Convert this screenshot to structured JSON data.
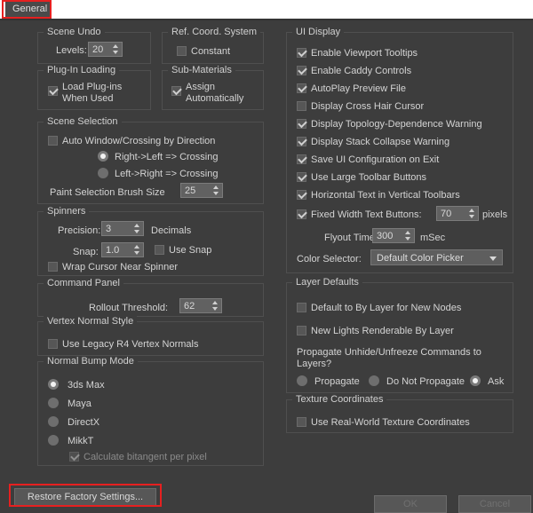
{
  "tabs": [
    {
      "label": "General",
      "selected": true
    }
  ],
  "left_column": {
    "scene_undo": {
      "title": "Scene Undo",
      "levels_label": "Levels:",
      "levels_value": "20"
    },
    "ref_coord_system": {
      "title": "Ref. Coord. System",
      "constant_label": "Constant",
      "constant_checked": false
    },
    "plugin_loading": {
      "title": "Plug-In Loading",
      "load_plugins_label_line1": "Load Plug-ins",
      "load_plugins_label_line2": "When Used",
      "load_plugins_checked": true
    },
    "sub_materials": {
      "title": "Sub-Materials",
      "assign_label_line1": "Assign",
      "assign_label_line2": "Automatically",
      "assign_checked": true
    },
    "scene_selection": {
      "title": "Scene Selection",
      "auto_window_label": "Auto Window/Crossing by Direction",
      "auto_window_checked": false,
      "right_left_label": "Right->Left => Crossing",
      "right_left_selected": true,
      "left_right_label": "Left->Right => Crossing",
      "left_right_selected": false,
      "brush_size_label": "Paint Selection Brush Size",
      "brush_size_value": "25"
    },
    "spinners": {
      "title": "Spinners",
      "precision_label": "Precision:",
      "precision_value": "3",
      "decimals_label": "Decimals",
      "snap_label": "Snap:",
      "snap_value": "1.0",
      "use_snap_label": "Use Snap",
      "use_snap_checked": false,
      "wrap_cursor_label": "Wrap Cursor Near Spinner",
      "wrap_cursor_checked": false
    },
    "command_panel": {
      "title": "Command Panel",
      "rollout_threshold_label": "Rollout Threshold:",
      "rollout_threshold_value": "62"
    },
    "vertex_normal_style": {
      "title": "Vertex Normal Style",
      "legacy_label": "Use Legacy R4 Vertex Normals",
      "legacy_checked": false
    },
    "normal_bump_mode": {
      "title": "Normal Bump Mode",
      "options": [
        {
          "label": "3ds Max",
          "selected": true
        },
        {
          "label": "Maya",
          "selected": false
        },
        {
          "label": "DirectX",
          "selected": false
        },
        {
          "label": "MikkT",
          "selected": false
        }
      ],
      "calculate_bitangent_label": "Calculate bitangent per pixel",
      "calculate_bitangent_checked": true,
      "calculate_bitangent_disabled": true
    }
  },
  "right_column": {
    "ui_display": {
      "title": "UI Display",
      "items": [
        {
          "label": "Enable Viewport Tooltips",
          "checked": true
        },
        {
          "label": "Enable Caddy Controls",
          "checked": true
        },
        {
          "label": "AutoPlay Preview File",
          "checked": true
        },
        {
          "label": "Display Cross Hair Cursor",
          "checked": false
        },
        {
          "label": "Display Topology-Dependence Warning",
          "checked": true
        },
        {
          "label": "Display Stack Collapse Warning",
          "checked": true
        },
        {
          "label": "Save UI Configuration on Exit",
          "checked": true
        },
        {
          "label": "Use Large Toolbar Buttons",
          "checked": true
        },
        {
          "label": "Horizontal Text in Vertical Toolbars",
          "checked": true
        }
      ],
      "fixed_width_label": "Fixed Width Text Buttons:",
      "fixed_width_checked": true,
      "fixed_width_value": "70",
      "pixels_label": "pixels",
      "flyout_time_label": "Flyout Time:",
      "flyout_time_value": "300",
      "msec_label": "mSec",
      "color_selector_label": "Color Selector:",
      "color_selector_value": "Default Color Picker"
    },
    "layer_defaults": {
      "title": "Layer Defaults",
      "default_bylayer_label": "Default to By Layer for New Nodes",
      "default_bylayer_checked": false,
      "new_lights_label": "New Lights Renderable By Layer",
      "new_lights_checked": false,
      "propagate_question_line1": "Propagate Unhide/Unfreeze Commands to",
      "propagate_question_line2": "Layers?",
      "propagate_options": [
        {
          "label": "Propagate",
          "selected": false
        },
        {
          "label": "Do Not Propagate",
          "selected": false
        },
        {
          "label": "Ask",
          "selected": true
        }
      ]
    },
    "texture_coordinates": {
      "title": "Texture Coordinates",
      "real_world_label": "Use Real-World Texture Coordinates",
      "real_world_checked": false
    }
  },
  "footer": {
    "restore_label": "Restore Factory Settings...",
    "ok_label": "OK",
    "cancel_label": "Cancel"
  },
  "colors": {
    "background": "#3d3d3d",
    "highlight_red": "#e62020",
    "group_border": "#4f4f4f",
    "text": "#d4d4d4"
  }
}
